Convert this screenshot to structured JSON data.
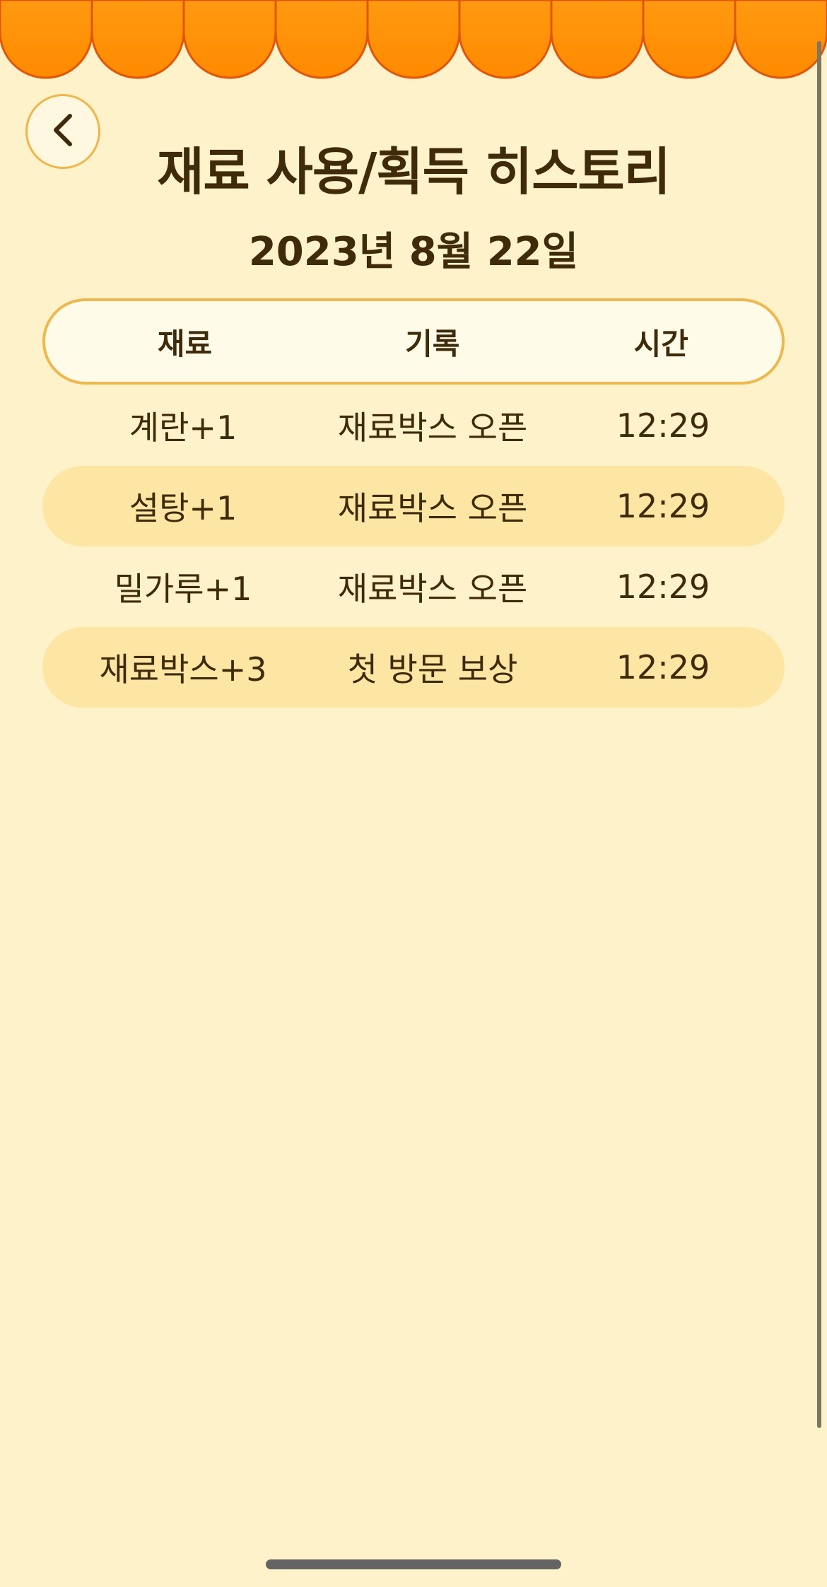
{
  "colors": {
    "background": "#fdf2c9",
    "awning": "#ff8a00",
    "awning_edge": "#e2550b",
    "row_highlight": "#fde6a4",
    "header_border": "#efb74e",
    "text": "#3f2a0a"
  },
  "header": {
    "back_icon": "chevron-left-icon",
    "title": "재료 사용/획득 히스토리",
    "date": "2023년 8월 22일"
  },
  "table": {
    "columns": [
      "재료",
      "기록",
      "시간"
    ],
    "rows": [
      {
        "item": "계란+1",
        "record": "재료박스 오픈",
        "time": "12:29"
      },
      {
        "item": "설탕+1",
        "record": "재료박스 오픈",
        "time": "12:29"
      },
      {
        "item": "밀가루+1",
        "record": "재료박스 오픈",
        "time": "12:29"
      },
      {
        "item": "재료박스+3",
        "record": "첫 방문 보상",
        "time": "12:29"
      }
    ]
  }
}
